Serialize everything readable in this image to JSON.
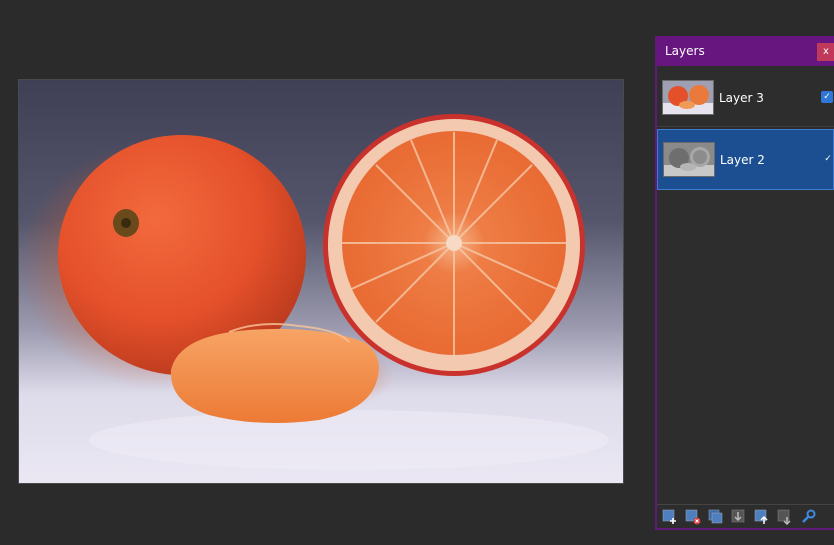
{
  "panel": {
    "title": "Layers",
    "close_label": "x"
  },
  "layers": [
    {
      "name": "Layer 3",
      "visible": true,
      "selected": false
    },
    {
      "name": "Layer 2",
      "visible": true,
      "selected": true
    }
  ],
  "toolbar_icons": [
    "add-layer-icon",
    "delete-layer-icon",
    "duplicate-layer-icon",
    "merge-down-icon",
    "move-layer-up-icon",
    "move-layer-down-icon",
    "layer-properties-icon"
  ],
  "colors": {
    "panel_header": "#67157f",
    "selected_row": "#1c4f92",
    "background": "#2b2b2b",
    "checkbox": "#2f76d6"
  }
}
